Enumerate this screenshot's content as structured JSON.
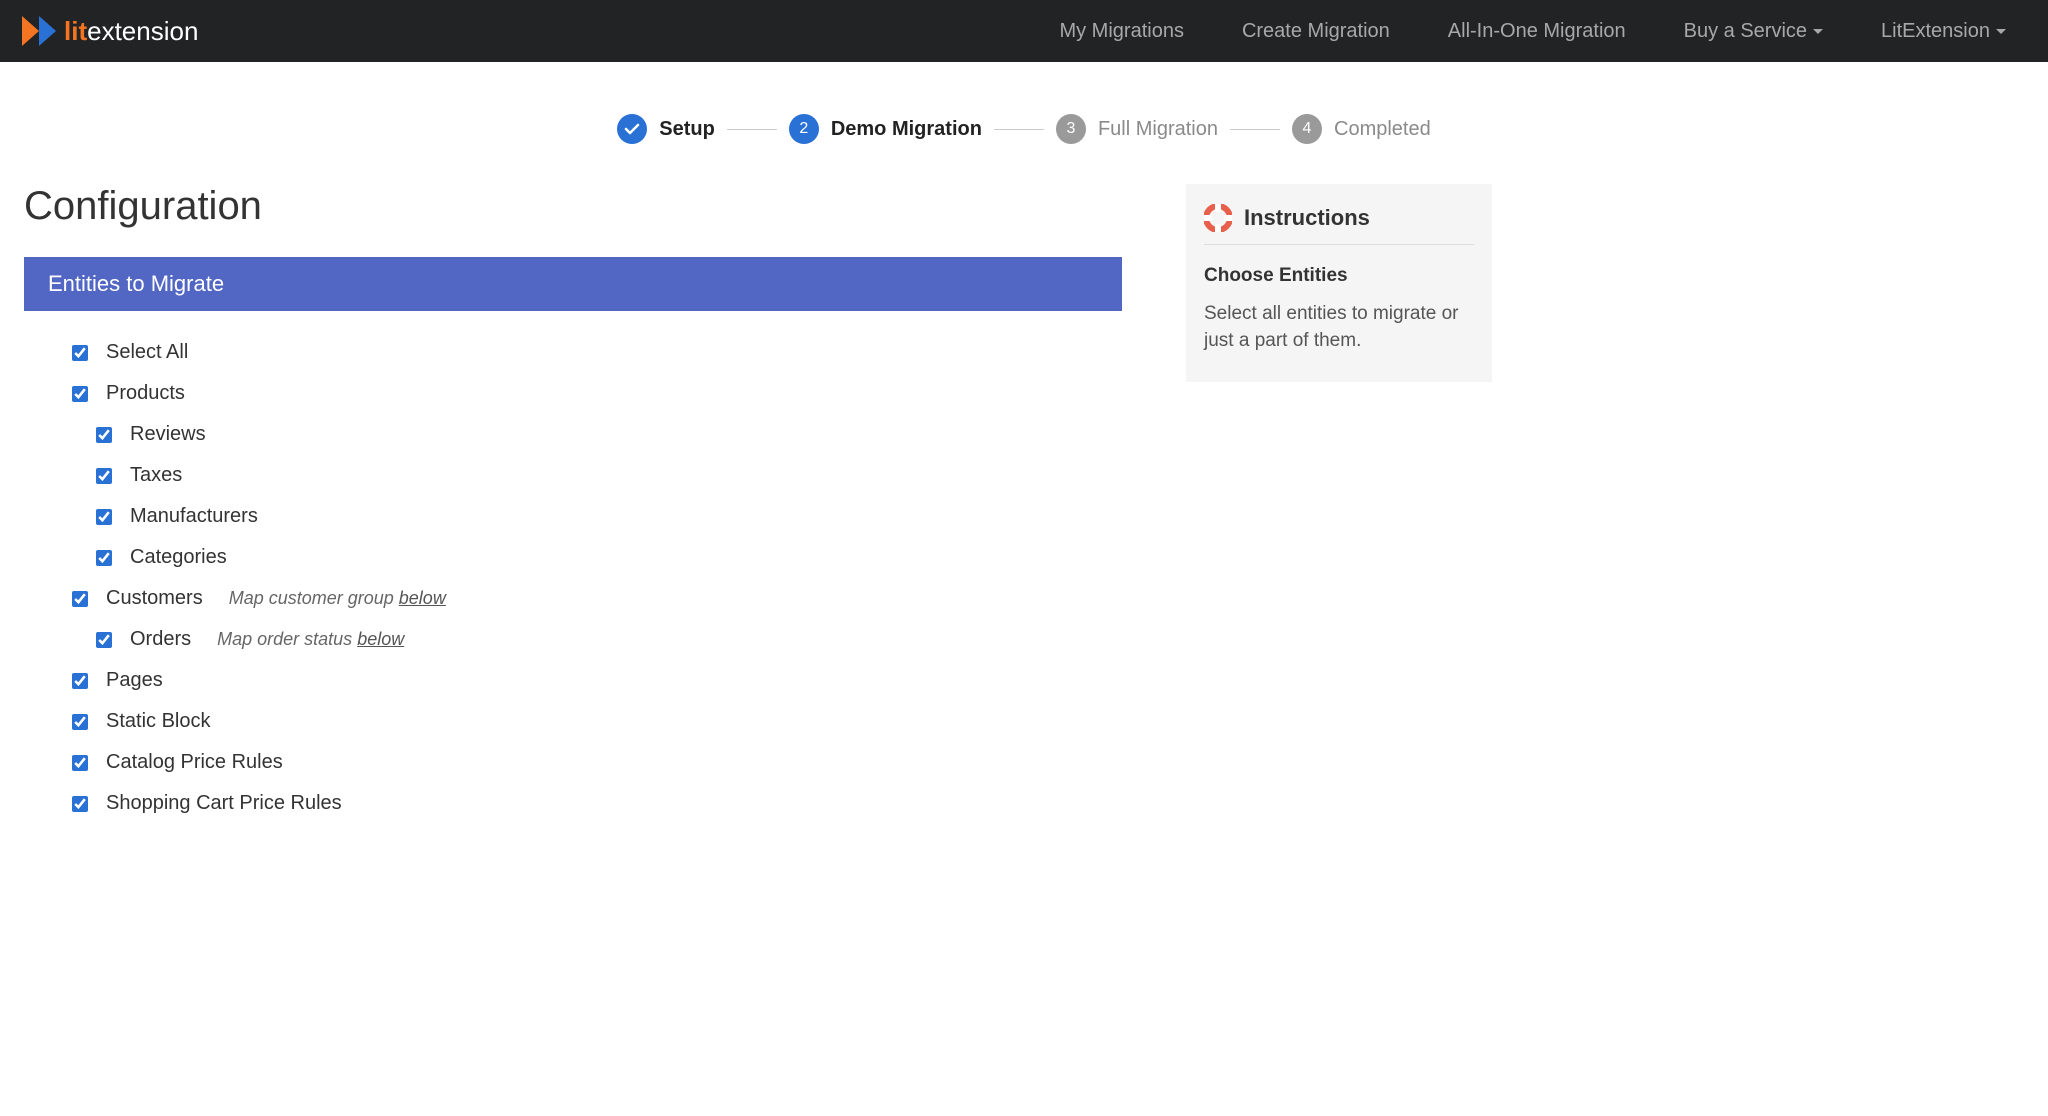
{
  "navbar": {
    "logo_lit": "lit",
    "logo_ext": "extension",
    "items": [
      {
        "label": "My Migrations",
        "dropdown": false
      },
      {
        "label": "Create Migration",
        "dropdown": false
      },
      {
        "label": "All-In-One Migration",
        "dropdown": false
      },
      {
        "label": "Buy a Service",
        "dropdown": true
      },
      {
        "label": "LitExtension",
        "dropdown": true
      }
    ]
  },
  "stepper": [
    {
      "num": "1",
      "label": "Setup",
      "state": "done"
    },
    {
      "num": "2",
      "label": "Demo Migration",
      "state": "current"
    },
    {
      "num": "3",
      "label": "Full Migration",
      "state": "pending"
    },
    {
      "num": "4",
      "label": "Completed",
      "state": "pending"
    }
  ],
  "page_title": "Configuration",
  "panel_header": "Entities to Migrate",
  "entities": [
    {
      "label": "Select All",
      "checked": true,
      "child": false
    },
    {
      "label": "Products",
      "checked": true,
      "child": false
    },
    {
      "label": "Reviews",
      "checked": true,
      "child": true
    },
    {
      "label": "Taxes",
      "checked": true,
      "child": true
    },
    {
      "label": "Manufacturers",
      "checked": true,
      "child": true
    },
    {
      "label": "Categories",
      "checked": true,
      "child": true
    },
    {
      "label": "Customers",
      "checked": true,
      "child": false,
      "hint": "Map customer group ",
      "hint_link": "below"
    },
    {
      "label": "Orders",
      "checked": true,
      "child": true,
      "hint": "Map order status ",
      "hint_link": "below"
    },
    {
      "label": "Pages",
      "checked": true,
      "child": false
    },
    {
      "label": "Static Block",
      "checked": true,
      "child": false
    },
    {
      "label": "Catalog Price Rules",
      "checked": true,
      "child": false
    },
    {
      "label": "Shopping Cart Price Rules",
      "checked": true,
      "child": false
    }
  ],
  "instructions": {
    "title": "Instructions",
    "subtitle": "Choose Entities",
    "body": "Select all entities to migrate or just a part of them."
  }
}
